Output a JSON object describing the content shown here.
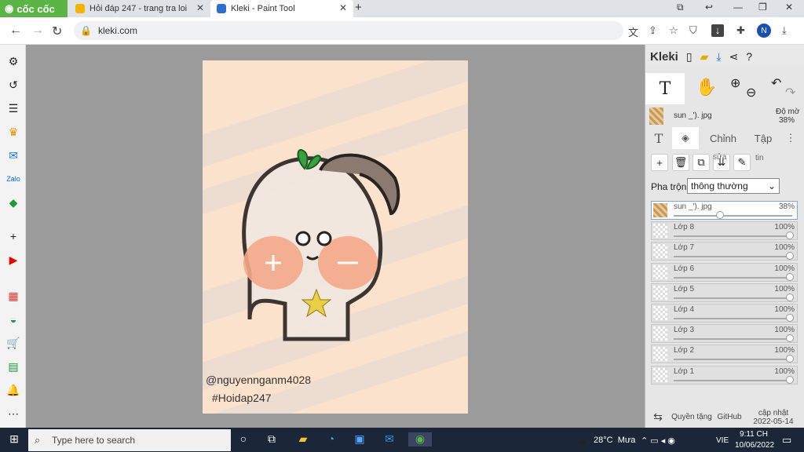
{
  "browser": {
    "brand": "cốc cốc",
    "tabs": [
      {
        "title": "Hỏi đáp 247 - trang tra loi"
      },
      {
        "title": "Kleki - Paint Tool"
      }
    ],
    "url": "kleki.com",
    "avatar_letter": "N"
  },
  "canvas": {
    "watermark_handle": "@nguyennganm4028",
    "watermark_tag": "#Hoidap247"
  },
  "kleki": {
    "logo": "Kleki",
    "active_tool": "T",
    "layer_image_name": "sun _'). jpg",
    "opacity_label": "Độ mờ",
    "opacity_value": "38%",
    "panel_tabs": [
      "T",
      "Chỉnh",
      "Tập"
    ],
    "layer_buttons_label": "sửa",
    "layer_buttons_label2": "tin",
    "blend_label": "Pha trộn",
    "blend_value": "thông thường",
    "layers": [
      {
        "name": "sun _'). jpg",
        "opacity": "38%",
        "fraction": 0.38
      },
      {
        "name": "Lớp 8",
        "opacity": "100%",
        "fraction": 1
      },
      {
        "name": "Lớp 7",
        "opacity": "100%",
        "fraction": 1
      },
      {
        "name": "Lớp 6",
        "opacity": "100%",
        "fraction": 1
      },
      {
        "name": "Lớp 5",
        "opacity": "100%",
        "fraction": 1
      },
      {
        "name": "Lớp 4",
        "opacity": "100%",
        "fraction": 1
      },
      {
        "name": "Lớp 3",
        "opacity": "100%",
        "fraction": 1
      },
      {
        "name": "Lớp 2",
        "opacity": "100%",
        "fraction": 1
      },
      {
        "name": "Lớp 1",
        "opacity": "100%",
        "fraction": 1
      }
    ],
    "footer": {
      "privacy": "Quyền tặng",
      "github": "GitHub",
      "update_label": "cập nhật",
      "update_date": "2022-05-14"
    }
  },
  "taskbar": {
    "search_placeholder": "Type here to search",
    "weather": "28°C  Mưa",
    "lang": "VIE",
    "time": "9:11 CH",
    "date": "10/06/2022"
  }
}
